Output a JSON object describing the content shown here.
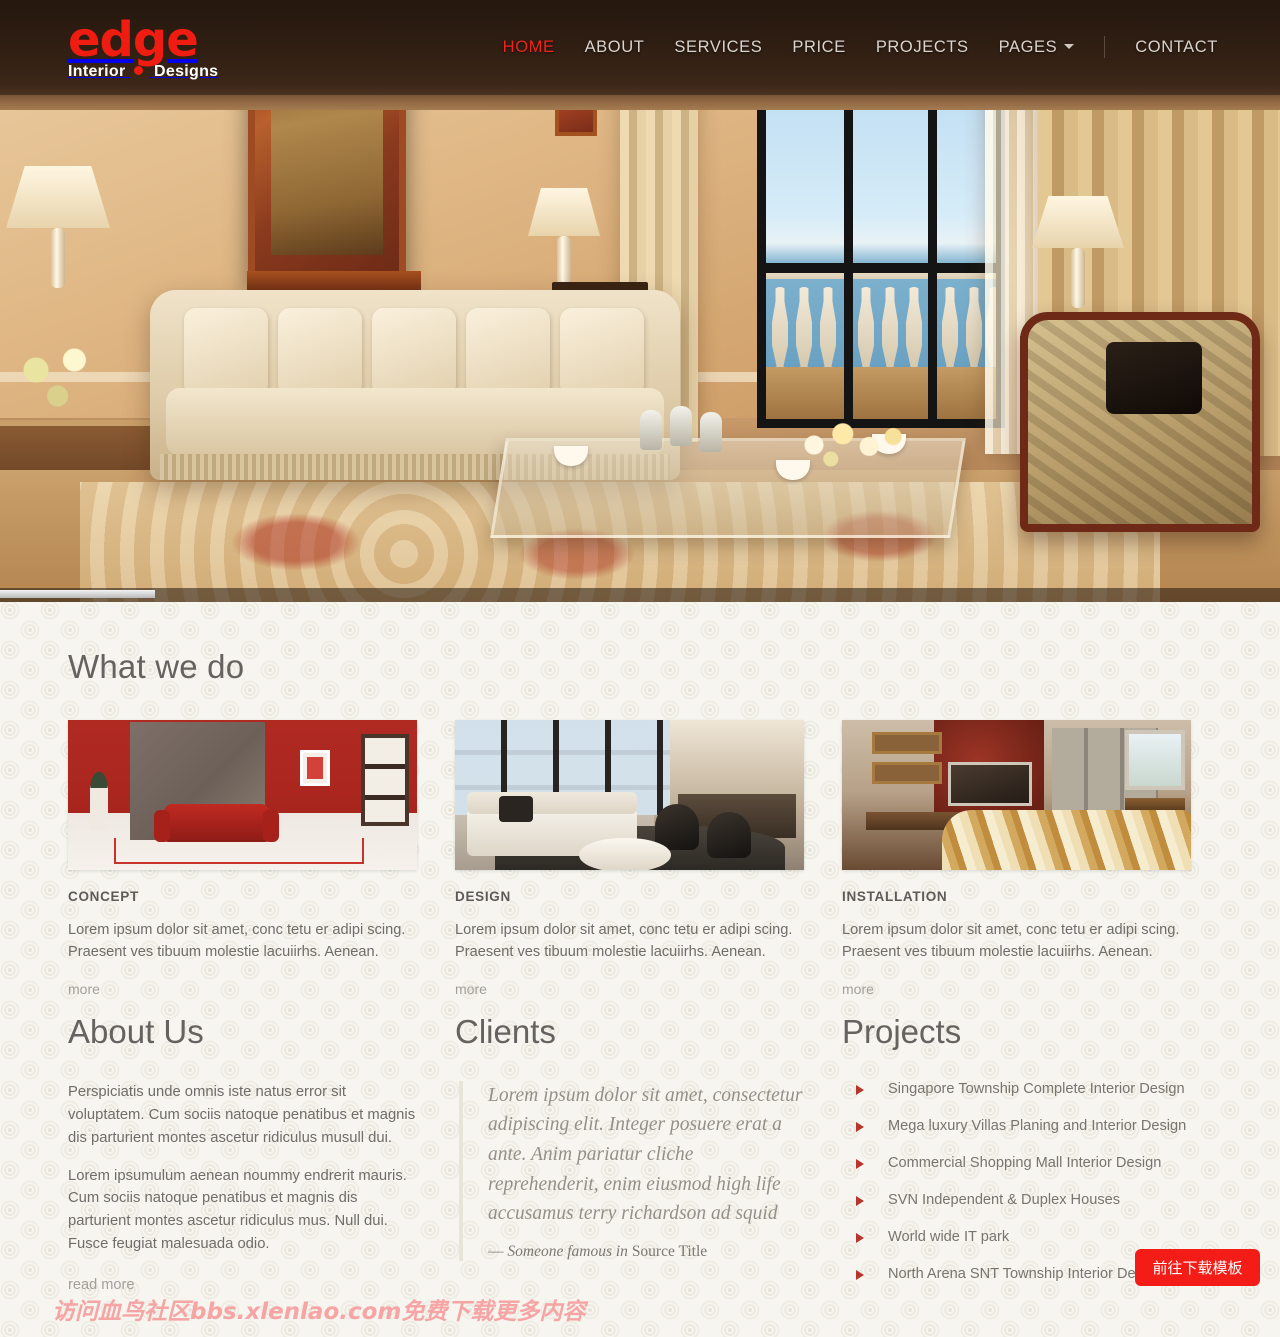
{
  "brand": {
    "name": "edge",
    "tagline_left": "Interior",
    "tagline_right": "Designs"
  },
  "nav": {
    "items": [
      {
        "label": "HOME",
        "active": true,
        "caret": false
      },
      {
        "label": "ABOUT",
        "active": false,
        "caret": false
      },
      {
        "label": "SERVICES",
        "active": false,
        "caret": false
      },
      {
        "label": "PRICE",
        "active": false,
        "caret": false
      },
      {
        "label": "PROJECTS",
        "active": false,
        "caret": false
      },
      {
        "label": "PAGES",
        "active": false,
        "caret": true
      },
      {
        "label": "CONTACT",
        "active": false,
        "caret": false
      }
    ]
  },
  "hero": {
    "alt": "luxury living room interior with sea view balcony",
    "progress_percent": 12
  },
  "services_section": {
    "heading": "What we do",
    "cards": [
      {
        "title": "CONCEPT",
        "body": "Lorem ipsum dolor sit amet, conc tetu er adipi scing. Praesent ves tibuum molestie lacuiirhs. Aenean.",
        "more": "more",
        "image_alt": "red living room with red sofa"
      },
      {
        "title": "DESIGN",
        "body": "Lorem ipsum dolor sit amet, conc tetu er adipi scing. Praesent ves tibuum molestie lacuiirhs. Aenean.",
        "more": "more",
        "image_alt": "modern living room with white sofa and large windows"
      },
      {
        "title": "INSTALLATION",
        "body": "Lorem ipsum dolor sit amet, conc tetu er adipi scing. Praesent ves tibuum molestie lacuiirhs. Aenean.",
        "more": "more",
        "image_alt": "bedroom with wall mounted tv and striped bedspread"
      }
    ]
  },
  "about": {
    "heading": "About Us",
    "paragraph1": "Perspiciatis unde omnis iste natus error sit voluptatem. Cum sociis natoque penatibus et magnis dis parturient montes ascetur ridiculus musull dui.",
    "paragraph2": "Lorem ipsumulum aenean noummy endrerit mauris. Cum sociis natoque penatibus et magnis dis parturient montes ascetur ridiculus mus. Null dui. Fusce feugiat malesuada odio.",
    "read_more": "read more"
  },
  "clients": {
    "heading": "Clients",
    "quote": "Lorem ipsum dolor sit amet, consectetur adipiscing elit. Integer posuere erat a ante. Anim pariatur cliche reprehenderit, enim eiusmod high life accusamus terry richardson ad squid",
    "attribution_dash": "— ",
    "attribution_name": "Someone famous",
    "attribution_in": " in ",
    "attribution_source": "Source Title"
  },
  "projects": {
    "heading": "Projects",
    "items": [
      "Singapore Township Complete Interior Design",
      "Mega luxury Villas Planing and Interior Design",
      "Commercial Shopping Mall Interior Design",
      "SVN Independent & Duplex Houses",
      "World wide IT park",
      "North Arena SNT Township Interior Design"
    ]
  },
  "overlay": {
    "watermark": "访问血鸟社区bbs.xlenlao.com免费下载更多内容",
    "download_button": "前往下载模板"
  },
  "colors": {
    "brand_red": "#ee1c11",
    "nav_active": "#f0241b",
    "bullet_red": "#b8352c",
    "heading_gray": "#666260",
    "body_gray": "#6f6c69",
    "page_bg": "#f6f5ef",
    "button_red": "#f41c16",
    "watermark_pink": "#f6a4a4"
  }
}
